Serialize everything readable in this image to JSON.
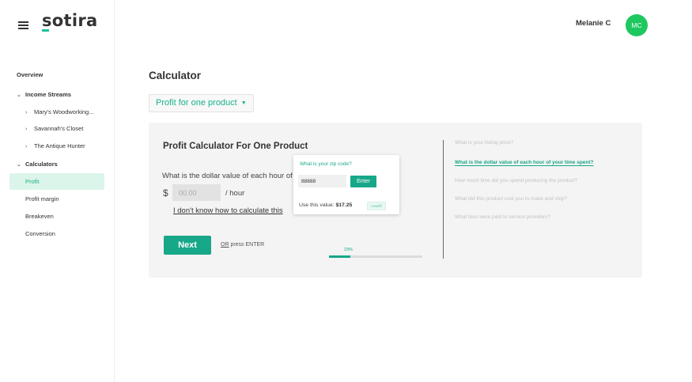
{
  "app": {
    "logo": "sotira"
  },
  "user": {
    "name": "Melanie C",
    "initials": "MC"
  },
  "sidebar": {
    "items": [
      {
        "label": "Overview",
        "chevron": "",
        "bold": true
      },
      {
        "label": "Income Streams",
        "chevron": "⌄",
        "bold": true
      },
      {
        "label": "Mary's Woodworking...",
        "chevron": "›"
      },
      {
        "label": "Savannah's Closet",
        "chevron": "›"
      },
      {
        "label": "The Antique Hunter",
        "chevron": "›"
      },
      {
        "label": "Calculators",
        "chevron": "⌄",
        "bold": true
      },
      {
        "label": "Profit",
        "active": true
      },
      {
        "label": "Profit margin"
      },
      {
        "label": "Breakeven"
      },
      {
        "label": "Conversion"
      }
    ]
  },
  "page": {
    "title": "Calculator",
    "dropdown": {
      "selected": "Profit for one product",
      "caret": "▼"
    }
  },
  "calculator": {
    "title": "Profit Calculator For One Product",
    "question": "What is the dollar value of each hour of your time spent?",
    "currency": "$",
    "amount_placeholder": "00.00",
    "unit": "/ hour",
    "help_link": "I don't know how to calculate this",
    "next_label": "Next",
    "or_label": "OR",
    "press_enter": " press ENTER",
    "progress": {
      "label": "23%",
      "value": 0.23
    }
  },
  "popup": {
    "title": "What is your zip code?",
    "zip_value": "88888",
    "enter_label": "Enter",
    "use_value_label": "Use this value: ",
    "use_value_amount": "$17.25",
    "autofill_label": "Autofill"
  },
  "steps": [
    {
      "label": "What is your listing price?"
    },
    {
      "label": "What is the dollar value of each hour of your time spent?",
      "current": true
    },
    {
      "label": "How much time did you spend producing the product?"
    },
    {
      "label": "What did this product cost you to make and ship?"
    },
    {
      "label": "What fees were paid to service providers?"
    }
  ],
  "colors": {
    "accent": "#17a789",
    "avatar": "#1ec85f",
    "active_bg": "#dcf5ea"
  }
}
